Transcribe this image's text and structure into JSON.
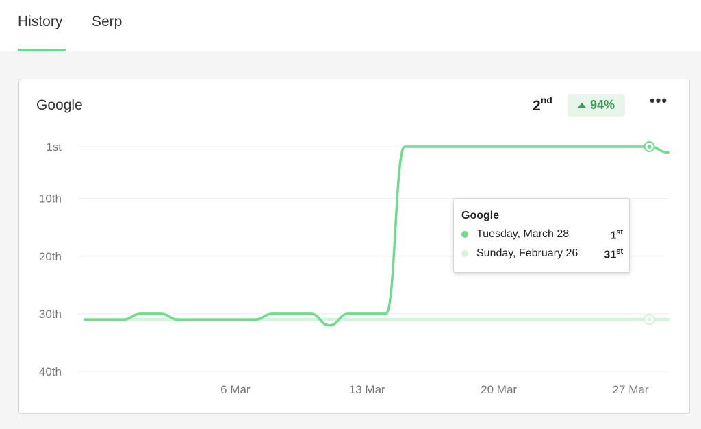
{
  "tabs": [
    {
      "label": "History",
      "active": true
    },
    {
      "label": "Serp",
      "active": false
    }
  ],
  "card": {
    "title": "Google",
    "rank": {
      "number": "2",
      "suffix": "nd"
    },
    "change": "94%",
    "more_icon": "more-horizontal-icon"
  },
  "tooltip": {
    "title": "Google",
    "rows": [
      {
        "label": "Tuesday, March 28",
        "value": "1",
        "suffix": "st",
        "color": "#6fdc8c"
      },
      {
        "label": "Sunday, February 26",
        "value": "31",
        "suffix": "st",
        "color": "#d5f3de"
      }
    ]
  },
  "colors": {
    "accent": "#6fd88f",
    "current_line": "#6fdc8c",
    "previous_line": "#d5f3de",
    "badge_bg": "#e8f5ea",
    "badge_text": "#3c9c57"
  },
  "chart_data": {
    "type": "line",
    "title": "Google",
    "xlabel": "",
    "ylabel": "",
    "y_inverted": true,
    "ylim": [
      1,
      40
    ],
    "yticks": [
      1,
      10,
      20,
      30,
      40
    ],
    "ytick_labels": [
      "1st",
      "10th",
      "20th",
      "30th",
      "40th"
    ],
    "x_start": "2023-02-26",
    "x_end": "2023-03-29",
    "xticks": [
      "2023-03-06",
      "2023-03-13",
      "2023-03-20",
      "2023-03-27"
    ],
    "xtick_labels": [
      "6 Mar",
      "13 Mar",
      "20 Mar",
      "27 Mar"
    ],
    "grid": true,
    "series": [
      {
        "name": "",
        "color": "#6fdc8c",
        "points": [
          [
            "2023-02-26",
            31
          ],
          [
            "2023-02-27",
            31
          ],
          [
            "2023-02-28",
            31
          ],
          [
            "2023-03-01",
            30
          ],
          [
            "2023-03-02",
            30
          ],
          [
            "2023-03-03",
            31
          ],
          [
            "2023-03-04",
            31
          ],
          [
            "2023-03-05",
            31
          ],
          [
            "2023-03-06",
            31
          ],
          [
            "2023-03-07",
            31
          ],
          [
            "2023-03-08",
            30
          ],
          [
            "2023-03-09",
            30
          ],
          [
            "2023-03-10",
            30
          ],
          [
            "2023-03-11",
            32
          ],
          [
            "2023-03-12",
            30
          ],
          [
            "2023-03-13",
            30
          ],
          [
            "2023-03-14",
            30
          ],
          [
            "2023-03-15",
            1
          ],
          [
            "2023-03-16",
            1
          ],
          [
            "2023-03-17",
            1
          ],
          [
            "2023-03-18",
            1
          ],
          [
            "2023-03-19",
            1
          ],
          [
            "2023-03-20",
            1
          ],
          [
            "2023-03-21",
            1
          ],
          [
            "2023-03-22",
            1
          ],
          [
            "2023-03-23",
            1
          ],
          [
            "2023-03-24",
            1
          ],
          [
            "2023-03-25",
            1
          ],
          [
            "2023-03-26",
            1
          ],
          [
            "2023-03-27",
            1
          ],
          [
            "2023-03-28",
            1
          ],
          [
            "2023-03-29",
            2
          ]
        ],
        "marker": [
          "2023-03-28",
          1
        ]
      },
      {
        "name": "",
        "color": "#d5f3de",
        "points": [
          [
            "2023-02-26",
            31
          ],
          [
            "2023-03-29",
            31
          ]
        ],
        "marker": [
          "2023-03-28",
          31
        ]
      }
    ]
  }
}
